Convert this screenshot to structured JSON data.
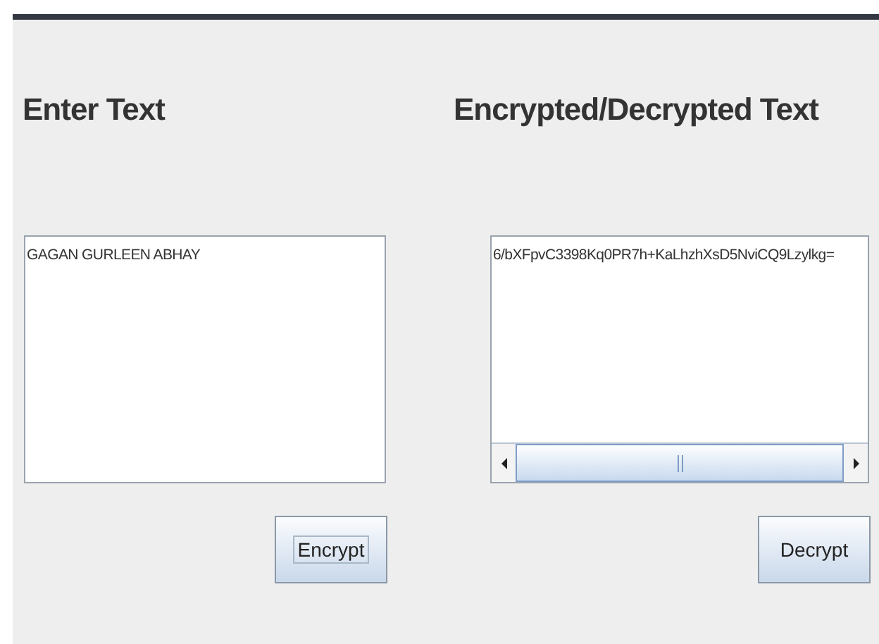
{
  "input_panel": {
    "heading": "Enter Text",
    "text": "GAGAN GURLEEN ABHAY",
    "button": "Encrypt",
    "button_focused": true
  },
  "output_panel": {
    "heading": "Encrypted/Decrypted Text",
    "text": "6/bXFpvC3398Kq0PR7h+KaLhzhXsD5NviCQ9Lzylkg=",
    "button": "Decrypt",
    "button_focused": false
  }
}
